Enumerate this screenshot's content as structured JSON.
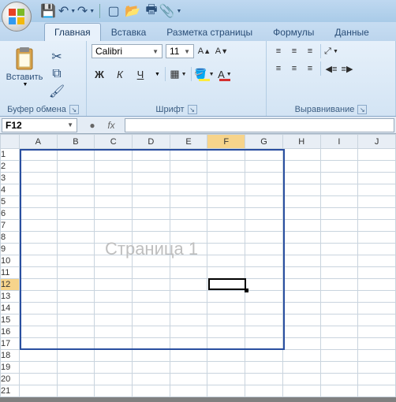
{
  "qat": {
    "icons": [
      "save-icon",
      "undo-icon",
      "redo-icon",
      "new-icon",
      "open-icon",
      "print-icon",
      "preview-icon"
    ]
  },
  "tabs": [
    {
      "label": "Главная",
      "active": true
    },
    {
      "label": "Вставка",
      "active": false
    },
    {
      "label": "Разметка страницы",
      "active": false
    },
    {
      "label": "Формулы",
      "active": false
    },
    {
      "label": "Данные",
      "active": false
    }
  ],
  "ribbon": {
    "clipboard": {
      "paste_label": "Вставить",
      "group_label": "Буфер обмена"
    },
    "font": {
      "name": "Calibri",
      "size": "11",
      "bold": "Ж",
      "italic": "К",
      "underline": "Ч",
      "group_label": "Шрифт"
    },
    "alignment": {
      "group_label": "Выравнивание"
    }
  },
  "namebox": {
    "value": "F12"
  },
  "fx_label": "fx",
  "formula_value": "",
  "sheet": {
    "columns": [
      "A",
      "B",
      "C",
      "D",
      "E",
      "F",
      "G",
      "H",
      "I",
      "J"
    ],
    "rows": [
      "1",
      "2",
      "3",
      "4",
      "5",
      "6",
      "7",
      "8",
      "9",
      "10",
      "11",
      "12",
      "13",
      "14",
      "15",
      "16",
      "17",
      "18",
      "19",
      "20",
      "21"
    ],
    "watermark": "Страница 1",
    "selected_cell": {
      "col": "F",
      "row": "12"
    },
    "print_area": {
      "from_col": "A",
      "to_col": "G",
      "from_row": "1",
      "to_row": "17"
    }
  },
  "colors": {
    "accent": "#2a4fa0",
    "ribbon_bg": "#d9e8f6"
  }
}
